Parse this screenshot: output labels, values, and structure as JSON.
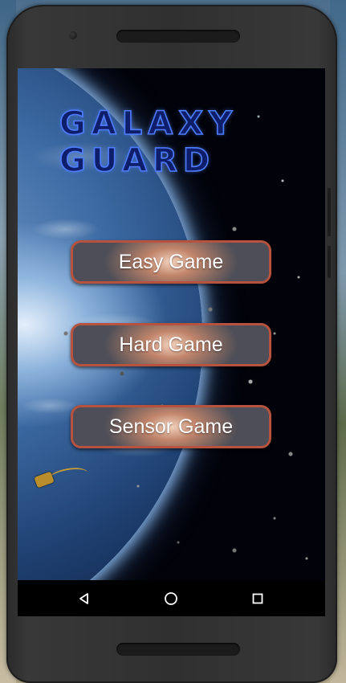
{
  "app": {
    "title": "GALAXY GUARD"
  },
  "menu": {
    "buttons": [
      {
        "label": "Easy Game"
      },
      {
        "label": "Hard Game"
      },
      {
        "label": "Sensor Game"
      }
    ]
  },
  "navigation_bar": {
    "buttons": [
      {
        "icon": "back-triangle-icon"
      },
      {
        "icon": "home-circle-icon"
      },
      {
        "icon": "recents-square-icon"
      }
    ]
  },
  "colors": {
    "title_blue": "#4f7dff",
    "button_border": "#b6523e",
    "button_glow": "#f3d2bd",
    "button_base": "#4d4e57",
    "phone_body": "#303030"
  }
}
